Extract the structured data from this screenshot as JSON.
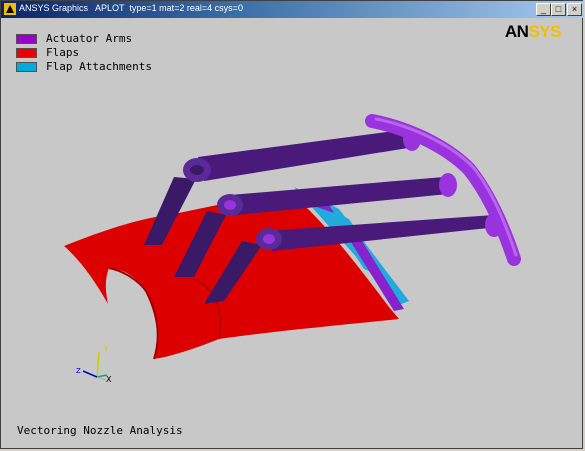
{
  "window": {
    "title": "ANSYS Graphics   APLOT  type=1 mat=2 real=4 csys=0",
    "buttons": {
      "minimize": "_",
      "maximize": "□",
      "close": "×"
    }
  },
  "legend": {
    "items": [
      {
        "label": "Actuator Arms",
        "color": "#9900cc"
      },
      {
        "label": "Flaps",
        "color": "#ee0000"
      },
      {
        "label": "Flap Attachments",
        "color": "#00aadd"
      }
    ]
  },
  "logo": {
    "part1": "AN",
    "part2": "SYS"
  },
  "triad": {
    "x_label": "X",
    "y_label": "Y",
    "z_label": "Z"
  },
  "caption": "Vectoring Nozzle Analysis",
  "colors": {
    "background": "#c8c8c8",
    "arm_light": "#9933dd",
    "arm_dark": "#3a1a66",
    "flap": "#dd0000",
    "attachment": "#22aadd"
  },
  "icons": [
    "ansys-app-icon",
    "minimize-icon",
    "maximize-icon",
    "close-icon",
    "triad-icon"
  ]
}
